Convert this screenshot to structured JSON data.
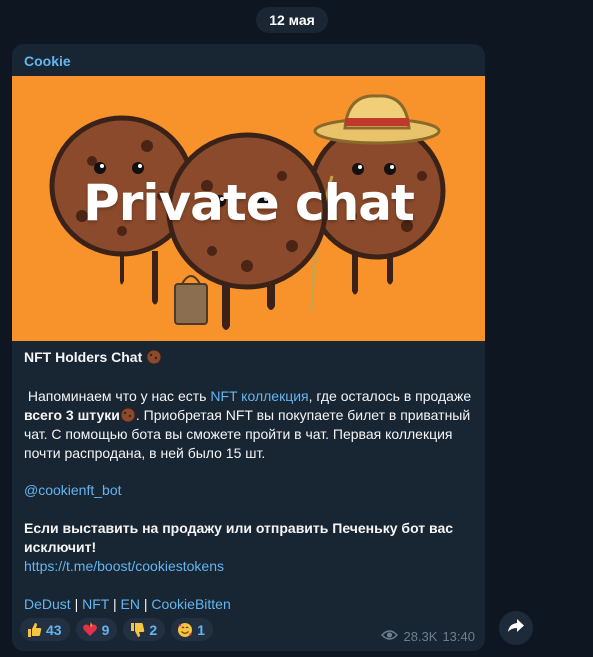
{
  "date_separator": "12 мая",
  "message": {
    "channel_name": "Cookie",
    "banner_title": "Private chat",
    "heading": "NFT Holders Chat",
    "para1_prefix": "Напоминаем что у нас есть ",
    "para1_link": "NFT коллекция",
    "para1_mid": ", где осталось в продаже ",
    "para1_bold": "всего 3 штуки",
    "para1_rest": ". Приобретая NFT вы покупаете билет в приватный чат. С помощью бота вы сможете пройти в чат. Первая коллекция почти распродана, в ней было 15 шт.",
    "bot_link": "@cookienft_bot",
    "warning": "Если выставить на продажу или отправить Печеньку бот вас исключит!",
    "boost_link": "https://t.me/boost/cookiestokens",
    "footer_links": [
      "DeDust",
      "NFT",
      "EN",
      "CookieBitten"
    ],
    "separator": "|",
    "reactions": [
      {
        "icon": "thumbs-up-icon",
        "count": "43"
      },
      {
        "icon": "heart-on-fire-icon",
        "count": "9"
      },
      {
        "icon": "thumbs-down-icon",
        "count": "2"
      },
      {
        "icon": "smiling-face-with-hearts-icon",
        "count": "1"
      }
    ],
    "views": "28.3K",
    "time": "13:40"
  },
  "colors": {
    "background": "#0e1621",
    "bubble": "#182533",
    "accent": "#64b5ef",
    "banner": "#f8932b"
  }
}
